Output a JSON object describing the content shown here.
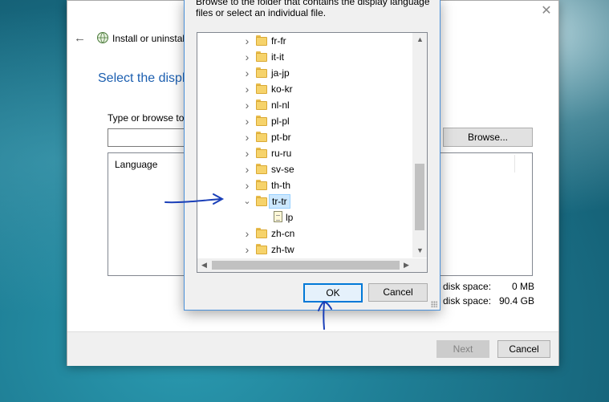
{
  "wizard": {
    "title": "Install or uninstal",
    "heading": "Select the displa",
    "browse_label": "Type or browse to",
    "browse_button": "Browse...",
    "list_header": "Language",
    "required_space_label": "disk space:",
    "required_space_value": "0 MB",
    "available_space_label": "disk space:",
    "available_space_value": "90.4 GB",
    "next_button": "Next",
    "cancel_button": "Cancel"
  },
  "dialog": {
    "description": "Browse to the folder that contains the display language files or select an individual file.",
    "tree": [
      {
        "label": "fr-fr",
        "type": "folder",
        "state": "collapsed"
      },
      {
        "label": "it-it",
        "type": "folder",
        "state": "collapsed"
      },
      {
        "label": "ja-jp",
        "type": "folder",
        "state": "collapsed"
      },
      {
        "label": "ko-kr",
        "type": "folder",
        "state": "collapsed"
      },
      {
        "label": "nl-nl",
        "type": "folder",
        "state": "collapsed"
      },
      {
        "label": "pl-pl",
        "type": "folder",
        "state": "collapsed"
      },
      {
        "label": "pt-br",
        "type": "folder",
        "state": "collapsed"
      },
      {
        "label": "ru-ru",
        "type": "folder",
        "state": "collapsed"
      },
      {
        "label": "sv-se",
        "type": "folder",
        "state": "collapsed"
      },
      {
        "label": "th-th",
        "type": "folder",
        "state": "collapsed"
      },
      {
        "label": "tr-tr",
        "type": "folder",
        "state": "expanded",
        "selected": true
      },
      {
        "label": "lp",
        "type": "file",
        "child": true
      },
      {
        "label": "zh-cn",
        "type": "folder",
        "state": "collapsed"
      },
      {
        "label": "zh-tw",
        "type": "folder",
        "state": "collapsed"
      }
    ],
    "ok_button": "OK",
    "cancel_button": "Cancel"
  },
  "colors": {
    "accent": "#0078d7",
    "heading": "#1c5fb0",
    "annotation_ink": "#1a3fb8"
  }
}
